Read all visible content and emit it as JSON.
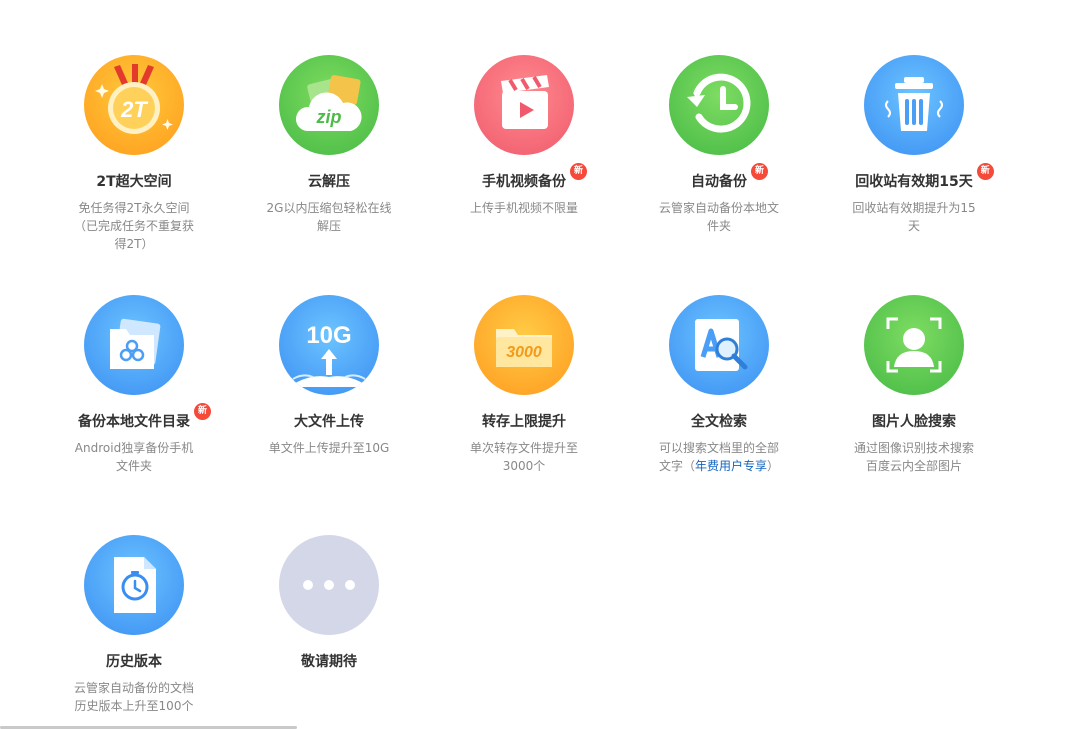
{
  "features": [
    {
      "title": "2T超大空间",
      "desc": "免任务得2T永久空间（已完成任务不重复获得2T）",
      "icon": "medal-2t-icon",
      "icon_text": "2T",
      "new": false
    },
    {
      "title": "云解压",
      "desc": "2G以内压缩包轻松在线解压",
      "icon": "zip-cloud-icon",
      "icon_text": "zip",
      "new": false
    },
    {
      "title": "手机视频备份",
      "desc": "上传手机视频不限量",
      "icon": "video-clapper-icon",
      "new": true
    },
    {
      "title": "自动备份",
      "desc": "云管家自动备份本地文件夹",
      "icon": "clock-backup-icon",
      "new": true
    },
    {
      "title": "回收站有效期15天",
      "desc": "回收站有效期提升为15天",
      "icon": "trash-bin-icon",
      "new": true
    },
    {
      "title": "备份本地文件目录",
      "desc": "Android独享备份手机文件夹",
      "icon": "folder-backup-icon",
      "new": true
    },
    {
      "title": "大文件上传",
      "desc": "单文件上传提升至10G",
      "icon": "upload-10g-icon",
      "icon_text": "10G",
      "new": false
    },
    {
      "title": "转存上限提升",
      "desc": "单次转存文件提升至3000个",
      "icon": "folder-3000-icon",
      "icon_text": "3000",
      "new": false
    },
    {
      "title": "全文检索",
      "desc": "可以搜索文档里的全部文字（",
      "desc_highlight": "年费用户专享",
      "desc_tail": "）",
      "icon": "document-search-icon",
      "new": false
    },
    {
      "title": "图片人脸搜索",
      "desc": "通过图像识别技术搜索百度云内全部图片",
      "icon": "face-scan-icon",
      "new": false
    },
    {
      "title": "历史版本",
      "desc": "云管家自动备份的文档历史版本上升至100个",
      "icon": "history-version-icon",
      "new": false
    },
    {
      "title": "敬请期待",
      "desc": "",
      "icon": "more-dots-icon",
      "new": false
    }
  ],
  "new_badge": "新",
  "colors": {
    "title": "#333333",
    "desc": "#888888",
    "highlight": "#1565c0",
    "badge": "#f5493a"
  }
}
